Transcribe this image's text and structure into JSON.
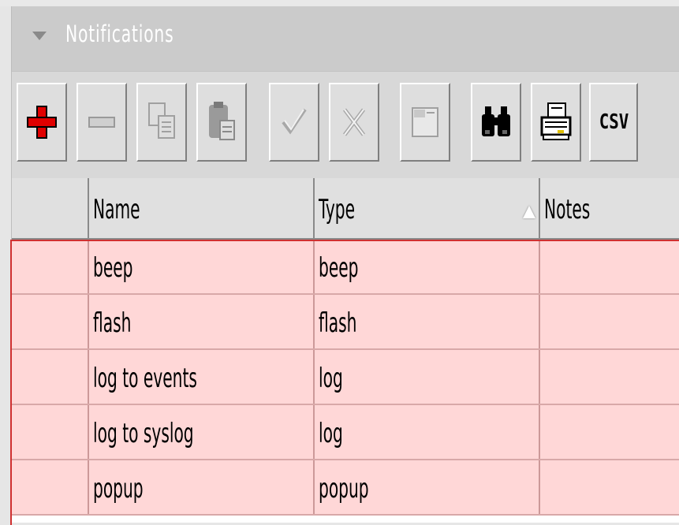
{
  "panel": {
    "title": "Notifications"
  },
  "toolbar": {
    "buttons": [
      {
        "name": "add-button",
        "icon": "plus-icon",
        "enabled": true
      },
      {
        "name": "remove-button",
        "icon": "minus-icon",
        "enabled": false
      },
      {
        "name": "copy-button",
        "icon": "copy-icon",
        "enabled": false
      },
      {
        "name": "paste-button",
        "icon": "paste-icon",
        "enabled": false
      },
      {
        "name": "enable-button",
        "icon": "check-icon",
        "enabled": false
      },
      {
        "name": "disable-button",
        "icon": "cross-icon",
        "enabled": false
      },
      {
        "name": "comment-button",
        "icon": "note-icon",
        "enabled": false
      },
      {
        "name": "find-button",
        "icon": "binoculars-icon",
        "enabled": true
      },
      {
        "name": "print-button",
        "icon": "printer-icon",
        "enabled": true
      },
      {
        "name": "csv-button",
        "icon": "csv-icon",
        "enabled": true,
        "label": "CSV"
      }
    ]
  },
  "table": {
    "columns": [
      "",
      "Name",
      "Type",
      "Notes"
    ],
    "sort_column": "Type",
    "rows": [
      {
        "name": "beep",
        "type": "beep",
        "notes": ""
      },
      {
        "name": "flash",
        "type": "flash",
        "notes": ""
      },
      {
        "name": "log to events",
        "type": "log",
        "notes": ""
      },
      {
        "name": "log to syslog",
        "type": "log",
        "notes": ""
      },
      {
        "name": "popup",
        "type": "popup",
        "notes": ""
      }
    ]
  },
  "colors": {
    "row_highlight": "#ffd7d7",
    "selection_border": "#d03030",
    "add_icon": "#e00000"
  }
}
